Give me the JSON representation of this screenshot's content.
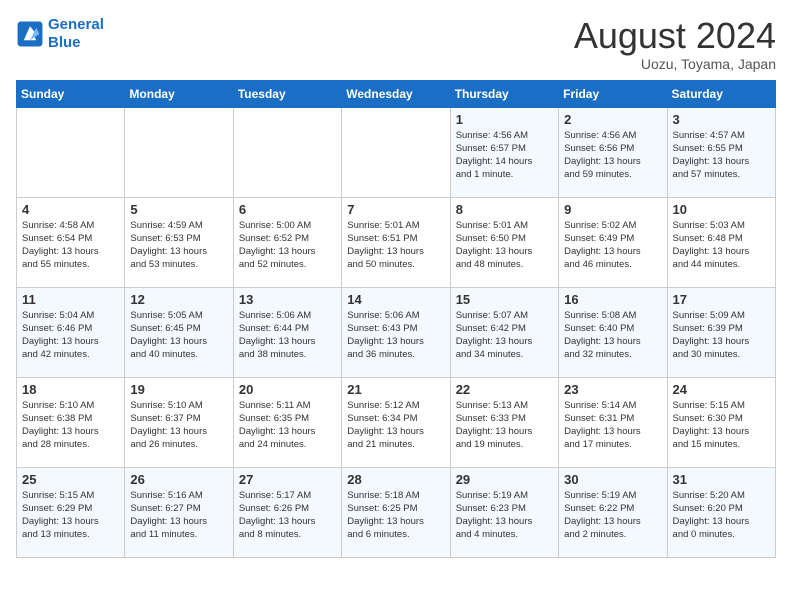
{
  "logo": {
    "line1": "General",
    "line2": "Blue"
  },
  "title": "August 2024",
  "location": "Uozu, Toyama, Japan",
  "weekdays": [
    "Sunday",
    "Monday",
    "Tuesday",
    "Wednesday",
    "Thursday",
    "Friday",
    "Saturday"
  ],
  "weeks": [
    [
      {
        "day": "",
        "info": ""
      },
      {
        "day": "",
        "info": ""
      },
      {
        "day": "",
        "info": ""
      },
      {
        "day": "",
        "info": ""
      },
      {
        "day": "1",
        "info": "Sunrise: 4:56 AM\nSunset: 6:57 PM\nDaylight: 14 hours\nand 1 minute."
      },
      {
        "day": "2",
        "info": "Sunrise: 4:56 AM\nSunset: 6:56 PM\nDaylight: 13 hours\nand 59 minutes."
      },
      {
        "day": "3",
        "info": "Sunrise: 4:57 AM\nSunset: 6:55 PM\nDaylight: 13 hours\nand 57 minutes."
      }
    ],
    [
      {
        "day": "4",
        "info": "Sunrise: 4:58 AM\nSunset: 6:54 PM\nDaylight: 13 hours\nand 55 minutes."
      },
      {
        "day": "5",
        "info": "Sunrise: 4:59 AM\nSunset: 6:53 PM\nDaylight: 13 hours\nand 53 minutes."
      },
      {
        "day": "6",
        "info": "Sunrise: 5:00 AM\nSunset: 6:52 PM\nDaylight: 13 hours\nand 52 minutes."
      },
      {
        "day": "7",
        "info": "Sunrise: 5:01 AM\nSunset: 6:51 PM\nDaylight: 13 hours\nand 50 minutes."
      },
      {
        "day": "8",
        "info": "Sunrise: 5:01 AM\nSunset: 6:50 PM\nDaylight: 13 hours\nand 48 minutes."
      },
      {
        "day": "9",
        "info": "Sunrise: 5:02 AM\nSunset: 6:49 PM\nDaylight: 13 hours\nand 46 minutes."
      },
      {
        "day": "10",
        "info": "Sunrise: 5:03 AM\nSunset: 6:48 PM\nDaylight: 13 hours\nand 44 minutes."
      }
    ],
    [
      {
        "day": "11",
        "info": "Sunrise: 5:04 AM\nSunset: 6:46 PM\nDaylight: 13 hours\nand 42 minutes."
      },
      {
        "day": "12",
        "info": "Sunrise: 5:05 AM\nSunset: 6:45 PM\nDaylight: 13 hours\nand 40 minutes."
      },
      {
        "day": "13",
        "info": "Sunrise: 5:06 AM\nSunset: 6:44 PM\nDaylight: 13 hours\nand 38 minutes."
      },
      {
        "day": "14",
        "info": "Sunrise: 5:06 AM\nSunset: 6:43 PM\nDaylight: 13 hours\nand 36 minutes."
      },
      {
        "day": "15",
        "info": "Sunrise: 5:07 AM\nSunset: 6:42 PM\nDaylight: 13 hours\nand 34 minutes."
      },
      {
        "day": "16",
        "info": "Sunrise: 5:08 AM\nSunset: 6:40 PM\nDaylight: 13 hours\nand 32 minutes."
      },
      {
        "day": "17",
        "info": "Sunrise: 5:09 AM\nSunset: 6:39 PM\nDaylight: 13 hours\nand 30 minutes."
      }
    ],
    [
      {
        "day": "18",
        "info": "Sunrise: 5:10 AM\nSunset: 6:38 PM\nDaylight: 13 hours\nand 28 minutes."
      },
      {
        "day": "19",
        "info": "Sunrise: 5:10 AM\nSunset: 6:37 PM\nDaylight: 13 hours\nand 26 minutes."
      },
      {
        "day": "20",
        "info": "Sunrise: 5:11 AM\nSunset: 6:35 PM\nDaylight: 13 hours\nand 24 minutes."
      },
      {
        "day": "21",
        "info": "Sunrise: 5:12 AM\nSunset: 6:34 PM\nDaylight: 13 hours\nand 21 minutes."
      },
      {
        "day": "22",
        "info": "Sunrise: 5:13 AM\nSunset: 6:33 PM\nDaylight: 13 hours\nand 19 minutes."
      },
      {
        "day": "23",
        "info": "Sunrise: 5:14 AM\nSunset: 6:31 PM\nDaylight: 13 hours\nand 17 minutes."
      },
      {
        "day": "24",
        "info": "Sunrise: 5:15 AM\nSunset: 6:30 PM\nDaylight: 13 hours\nand 15 minutes."
      }
    ],
    [
      {
        "day": "25",
        "info": "Sunrise: 5:15 AM\nSunset: 6:29 PM\nDaylight: 13 hours\nand 13 minutes."
      },
      {
        "day": "26",
        "info": "Sunrise: 5:16 AM\nSunset: 6:27 PM\nDaylight: 13 hours\nand 11 minutes."
      },
      {
        "day": "27",
        "info": "Sunrise: 5:17 AM\nSunset: 6:26 PM\nDaylight: 13 hours\nand 8 minutes."
      },
      {
        "day": "28",
        "info": "Sunrise: 5:18 AM\nSunset: 6:25 PM\nDaylight: 13 hours\nand 6 minutes."
      },
      {
        "day": "29",
        "info": "Sunrise: 5:19 AM\nSunset: 6:23 PM\nDaylight: 13 hours\nand 4 minutes."
      },
      {
        "day": "30",
        "info": "Sunrise: 5:19 AM\nSunset: 6:22 PM\nDaylight: 13 hours\nand 2 minutes."
      },
      {
        "day": "31",
        "info": "Sunrise: 5:20 AM\nSunset: 6:20 PM\nDaylight: 13 hours\nand 0 minutes."
      }
    ]
  ]
}
